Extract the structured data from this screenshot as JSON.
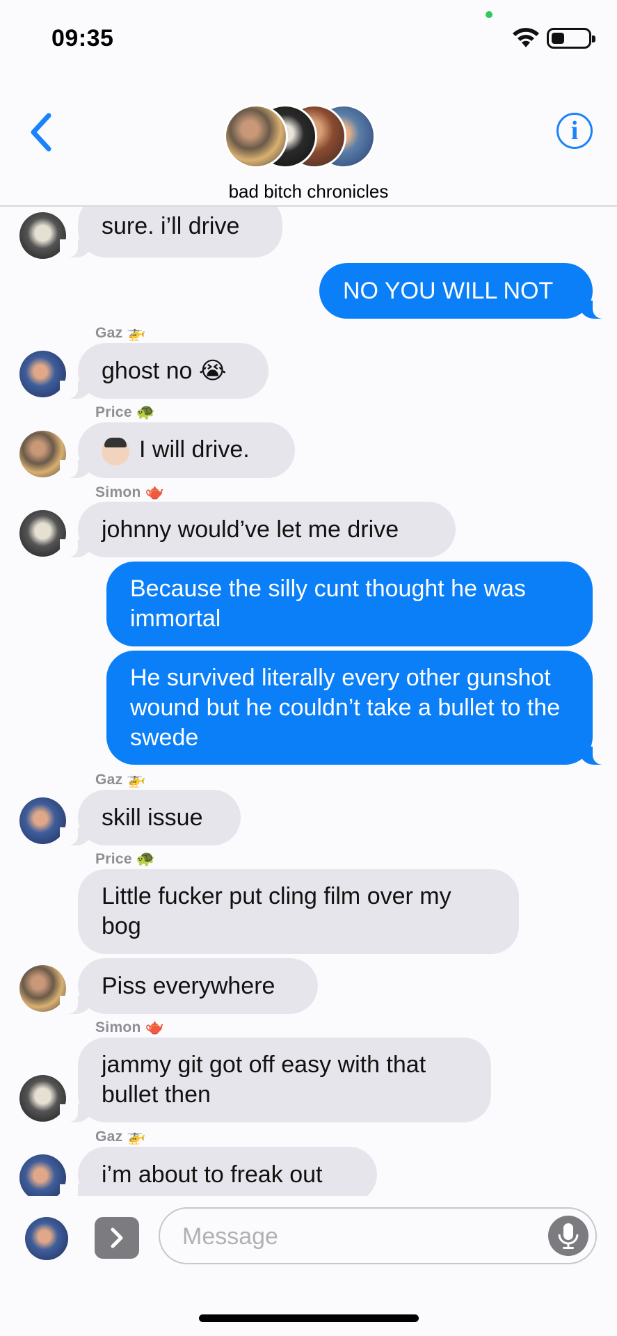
{
  "status_bar": {
    "time": "09:35"
  },
  "header": {
    "group_name": "bad bitch chronicles"
  },
  "thread": {
    "senders": {
      "gaz": {
        "name": "Gaz",
        "emoji": "🚁"
      },
      "price": {
        "name": "Price",
        "emoji": "🐢"
      },
      "simon": {
        "name": "Simon",
        "emoji": "🫖"
      }
    },
    "messages": [
      {
        "from": "Simon",
        "text": "sure. i’ll drive"
      },
      {
        "from": "me",
        "text": "NO YOU WILL NOT"
      },
      {
        "from": "Gaz",
        "text": "ghost no 😭"
      },
      {
        "from": "Price",
        "text": "I will drive."
      },
      {
        "from": "Simon",
        "text": "johnny would’ve let me drive"
      },
      {
        "from": "me",
        "text": "Because the silly cunt thought he was immortal"
      },
      {
        "from": "me",
        "text": "He survived literally every other gunshot wound but he couldn’t take a bullet to the swede"
      },
      {
        "from": "Gaz",
        "text": "skill issue"
      },
      {
        "from": "Price",
        "text": "Little fucker put cling film over my bog"
      },
      {
        "from": "Price",
        "text": "Piss everywhere"
      },
      {
        "from": "Simon",
        "text": "jammy git got off easy with that bullet then"
      },
      {
        "from": "Gaz",
        "text": "i’m about to freak out"
      }
    ]
  },
  "composer": {
    "placeholder": "Message"
  },
  "icons": [
    "back-chevron-icon",
    "info-icon",
    "wifi-icon",
    "battery-icon",
    "apps-chevron-icon",
    "microphone-icon"
  ],
  "colors": {
    "accent": "#0b7ff8",
    "incoming_bubble": "#e6e5eb",
    "background": "#fbfbfd",
    "sender_label": "#8e8e93"
  }
}
